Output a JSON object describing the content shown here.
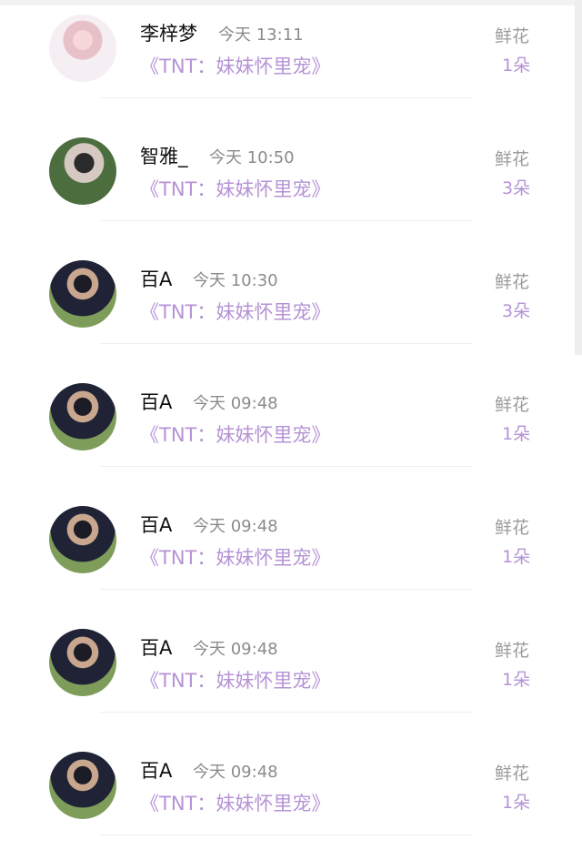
{
  "rows": [
    {
      "name": "李梓梦",
      "time": "今天 13:11",
      "book": "《TNT：妹妹怀里宠》",
      "gift_label": "鲜花",
      "gift_count": "1朵"
    },
    {
      "name": "智雅_",
      "time": "今天 10:50",
      "book": "《TNT：妹妹怀里宠》",
      "gift_label": "鲜花",
      "gift_count": "3朵"
    },
    {
      "name": "百A",
      "time": "今天 10:30",
      "book": "《TNT：妹妹怀里宠》",
      "gift_label": "鲜花",
      "gift_count": "3朵"
    },
    {
      "name": "百A",
      "time": "今天 09:48",
      "book": "《TNT：妹妹怀里宠》",
      "gift_label": "鲜花",
      "gift_count": "1朵"
    },
    {
      "name": "百A",
      "time": "今天 09:48",
      "book": "《TNT：妹妹怀里宠》",
      "gift_label": "鲜花",
      "gift_count": "1朵"
    },
    {
      "name": "百A",
      "time": "今天 09:48",
      "book": "《TNT：妹妹怀里宠》",
      "gift_label": "鲜花",
      "gift_count": "1朵"
    },
    {
      "name": "百A",
      "time": "今天 09:48",
      "book": "《TNT：妹妹怀里宠》",
      "gift_label": "鲜花",
      "gift_count": "1朵"
    }
  ],
  "colors": {
    "name": "#111111",
    "time": "#8b8b8b",
    "accent": "#b593d6",
    "label": "#9b9b9b"
  }
}
